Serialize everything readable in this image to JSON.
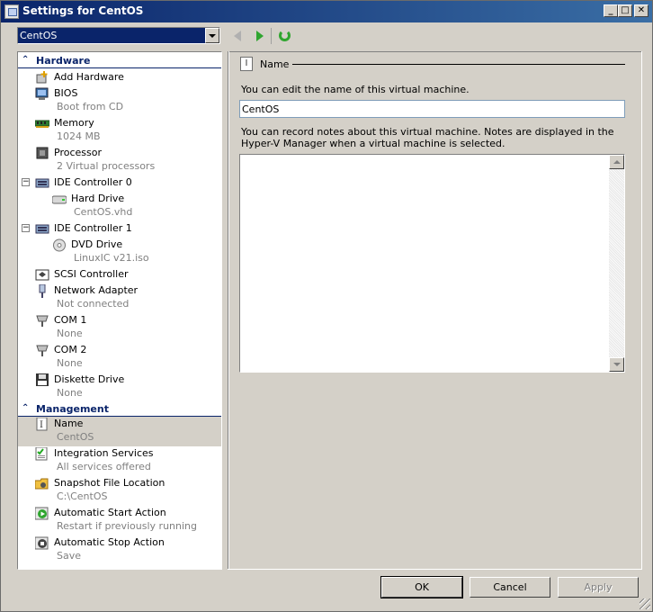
{
  "window": {
    "title": "Settings for CentOS"
  },
  "vm_selector": {
    "value": "CentOS"
  },
  "tree": {
    "hardware_header": "Hardware",
    "management_header": "Management",
    "hardware_items": [
      {
        "label": "Add Hardware",
        "sub": "",
        "icon": "add-hardware-icon"
      },
      {
        "label": "BIOS",
        "sub": "Boot from CD",
        "icon": "bios-icon"
      },
      {
        "label": "Memory",
        "sub": "1024 MB",
        "icon": "memory-icon"
      },
      {
        "label": "Processor",
        "sub": "2 Virtual processors",
        "icon": "processor-icon"
      },
      {
        "label": "IDE Controller 0",
        "sub": "",
        "icon": "ide-controller-icon"
      },
      {
        "label": "Hard Drive",
        "sub": "CentOS.vhd",
        "icon": "hard-drive-icon"
      },
      {
        "label": "IDE Controller 1",
        "sub": "",
        "icon": "ide-controller-icon"
      },
      {
        "label": "DVD Drive",
        "sub": "LinuxIC v21.iso",
        "icon": "dvd-drive-icon"
      },
      {
        "label": "SCSI Controller",
        "sub": "",
        "icon": "scsi-controller-icon"
      },
      {
        "label": "Network Adapter",
        "sub": "Not connected",
        "icon": "network-adapter-icon"
      },
      {
        "label": "COM 1",
        "sub": "None",
        "icon": "com-port-icon"
      },
      {
        "label": "COM 2",
        "sub": "None",
        "icon": "com-port-icon"
      },
      {
        "label": "Diskette Drive",
        "sub": "None",
        "icon": "diskette-icon"
      }
    ],
    "management_items": [
      {
        "label": "Name",
        "sub": "CentOS",
        "icon": "name-icon"
      },
      {
        "label": "Integration Services",
        "sub": "All services offered",
        "icon": "integration-services-icon"
      },
      {
        "label": "Snapshot File Location",
        "sub": "C:\\CentOS",
        "icon": "snapshot-folder-icon"
      },
      {
        "label": "Automatic Start Action",
        "sub": "Restart if previously running",
        "icon": "start-action-icon"
      },
      {
        "label": "Automatic Stop Action",
        "sub": "Save",
        "icon": "stop-action-icon"
      }
    ]
  },
  "detail": {
    "header": "Name",
    "name_hint": "You can edit the name of this virtual machine.",
    "name_value": "CentOS",
    "notes_hint": "You can record notes about this virtual machine. Notes are displayed in the Hyper-V Manager when a virtual machine is selected.",
    "notes_value": ""
  },
  "buttons": {
    "ok": "OK",
    "cancel": "Cancel",
    "apply": "Apply"
  }
}
